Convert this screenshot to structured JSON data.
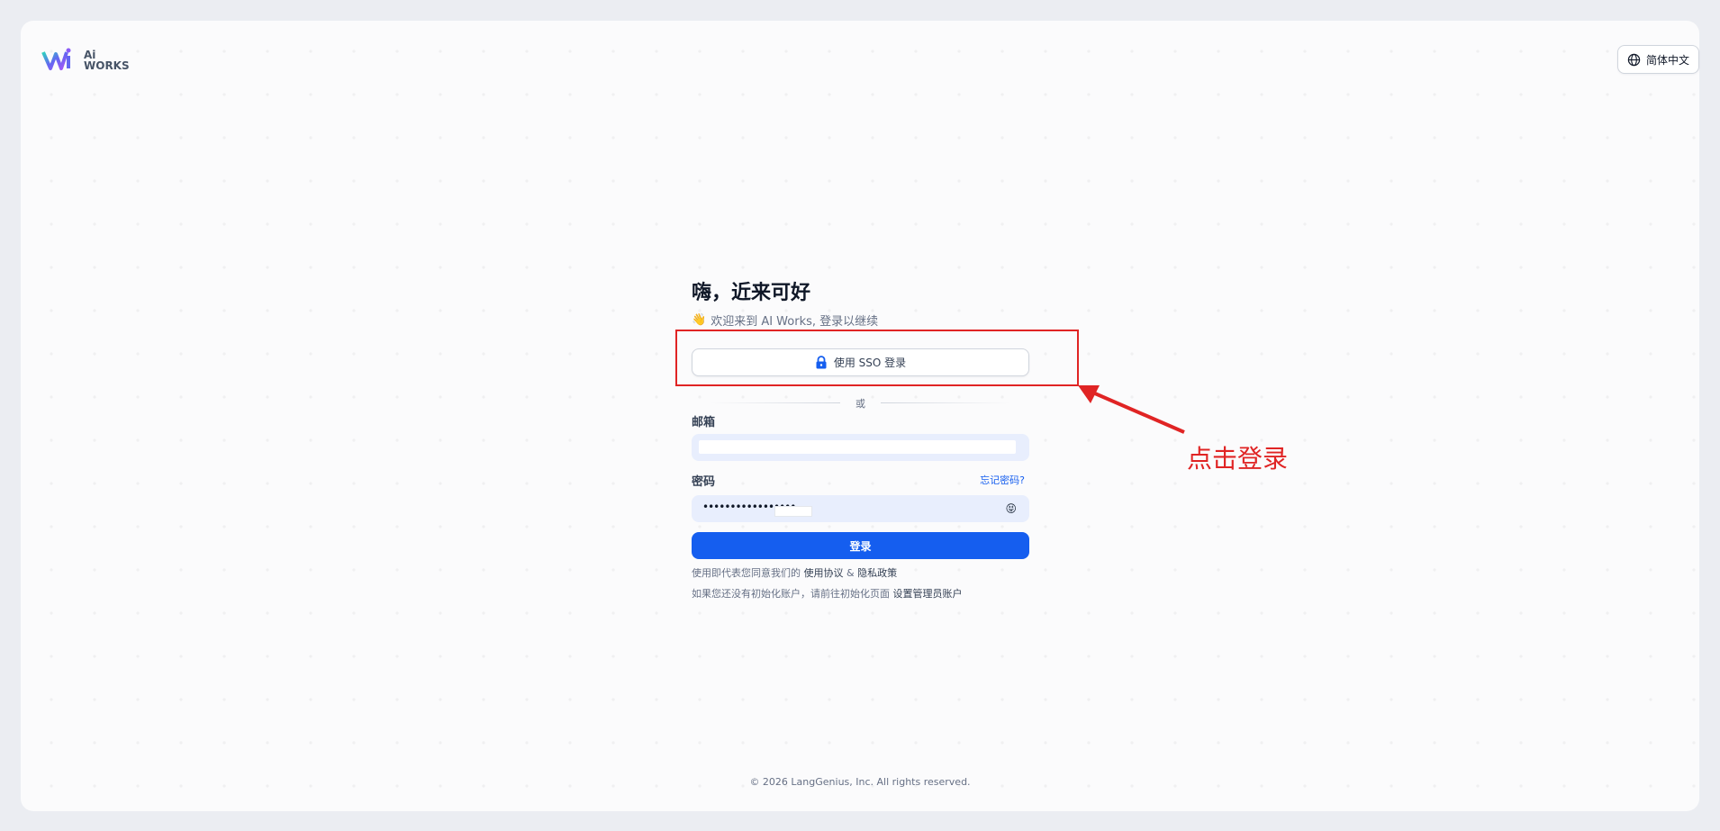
{
  "brand": {
    "logo_line1": "Ai",
    "logo_line2": "WORKS"
  },
  "header": {
    "language_label": "简体中文",
    "language_icon": "globe-icon"
  },
  "login": {
    "title": "嗨，近来可好",
    "subtitle_icon": "👋",
    "subtitle": "欢迎来到 AI Works, 登录以继续",
    "sso_button": "使用 SSO 登录",
    "divider_text": "或",
    "email_label": "邮箱",
    "email_value": "",
    "password_label": "密码",
    "forgot_password": "忘记密码?",
    "password_mask": "•••••••••••••••••",
    "login_button": "登录",
    "agreement_prefix": "使用即代表您同意我们的",
    "terms_link": "使用协议",
    "agreement_and": "&",
    "privacy_link": "隐私政策",
    "init_prefix": "如果您还没有初始化账户，请前往初始化页面",
    "init_link": "设置管理员账户"
  },
  "annotation": {
    "callout_text": "点击登录",
    "color": "#e02424"
  },
  "footer": {
    "copyright": "© 2026 LangGenius, Inc. All rights reserved."
  },
  "colors": {
    "primary": "#155eef",
    "background": "#ebedf2",
    "card": "#fbfbfc"
  }
}
